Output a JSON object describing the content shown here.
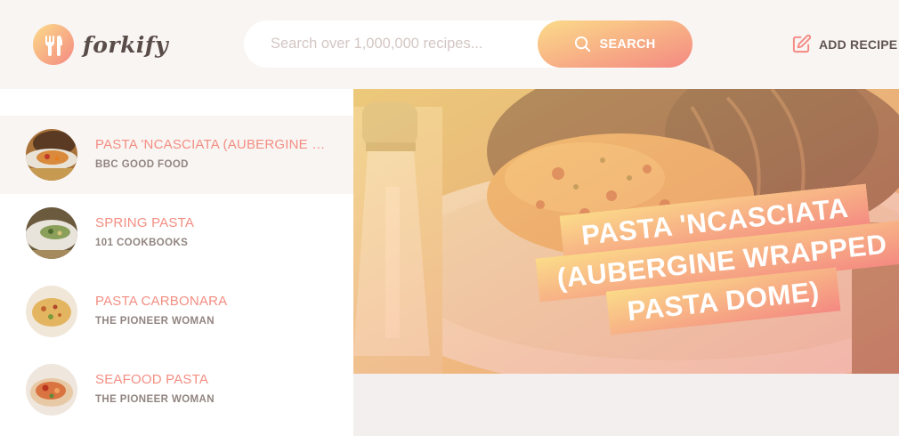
{
  "app": {
    "name": "forkify"
  },
  "icons": {
    "logo": "fork-knife-icon",
    "search": "search-icon",
    "add": "edit-icon"
  },
  "colors": {
    "gradient_start": "#fbdb89",
    "gradient_end": "#f48982",
    "accent_text": "#f38e82",
    "text": "#615551"
  },
  "search": {
    "placeholder": "Search over 1,000,000 recipes...",
    "value": "",
    "button_label": "SEARCH"
  },
  "nav": {
    "add_recipe_label": "ADD RECIPE"
  },
  "results": [
    {
      "title": "PASTA 'NCASCIATA (AUBERGINE WRAPPED PASTA DOME)",
      "publisher": "BBC GOOD FOOD",
      "active": true
    },
    {
      "title": "SPRING PASTA",
      "publisher": "101 COOKBOOKS",
      "active": false
    },
    {
      "title": "PASTA CARBONARA",
      "publisher": "THE PIONEER WOMAN",
      "active": false
    },
    {
      "title": "SEAFOOD PASTA",
      "publisher": "THE PIONEER WOMAN",
      "active": false
    }
  ],
  "recipe": {
    "title": "PASTA 'NCASCIATA (AUBERGINE WRAPPED PASTA DOME)"
  }
}
